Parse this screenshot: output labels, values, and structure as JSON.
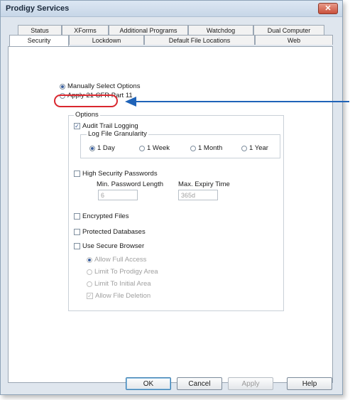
{
  "window": {
    "title": "Prodigy Services"
  },
  "tabs_back": [
    "Status",
    "XForms",
    "Additional Programs",
    "Watchdog",
    "Dual Computer"
  ],
  "tabs_front": [
    "Security",
    "Lockdown",
    "Default File Locations",
    "Web"
  ],
  "security": {
    "manual_label": "Manually Select Options",
    "cfr_label": "Apply 21 CFR Part 11",
    "options_title": "Options",
    "audit_label": "Audit Trail Logging",
    "granularity_title": "Log File Granularity",
    "granularity_options": [
      "1 Day",
      "1 Week",
      "1 Month",
      "1 Year"
    ],
    "hsp_label": "High Security Passwords",
    "min_len_label": "Min. Password Length",
    "min_len_value": "6",
    "max_expiry_label": "Max. Expiry Time",
    "max_expiry_value": "365d",
    "encrypted_label": "Encrypted Files",
    "protected_label": "Protected Databases",
    "secure_browser_label": "Use Secure Browser",
    "browser_options": [
      "Allow Full Access",
      "Limit To Prodigy Area",
      "Limit To Initial Area"
    ],
    "allow_deletion_label": "Allow File Deletion"
  },
  "buttons": {
    "ok": "OK",
    "cancel": "Cancel",
    "apply": "Apply",
    "help": "Help"
  },
  "icons": {
    "close": "close-icon",
    "arrow": "arrow-left-icon"
  },
  "colors": {
    "highlight": "#d9272e",
    "arrow": "#1f63b8"
  }
}
